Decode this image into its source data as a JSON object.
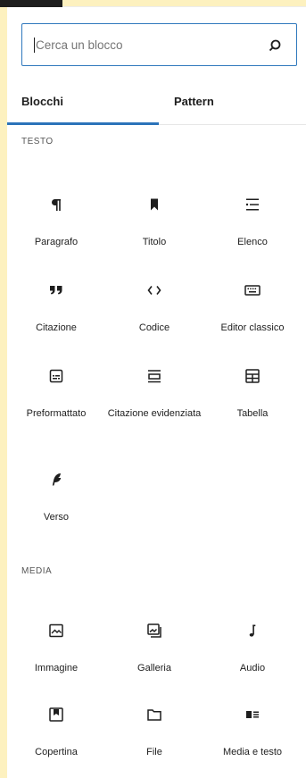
{
  "search": {
    "placeholder": "Cerca un blocco"
  },
  "tabs": [
    {
      "label": "Blocchi",
      "active": true
    },
    {
      "label": "Pattern",
      "active": false
    }
  ],
  "colors": {
    "accent": "#2c73b9",
    "background": "#fdf1bf"
  },
  "sections": [
    {
      "title": "TESTO",
      "blocks": [
        {
          "label": "Paragrafo",
          "icon": "paragraph-icon"
        },
        {
          "label": "Titolo",
          "icon": "heading-icon"
        },
        {
          "label": "Elenco",
          "icon": "list-icon"
        },
        {
          "label": "Citazione",
          "icon": "quote-icon"
        },
        {
          "label": "Codice",
          "icon": "code-icon"
        },
        {
          "label": "Editor classico",
          "icon": "keyboard-icon"
        },
        {
          "label": "Preformattato",
          "icon": "preformatted-icon"
        },
        {
          "label": "Citazione evidenziata",
          "icon": "pullquote-icon"
        },
        {
          "label": "Tabella",
          "icon": "table-icon"
        },
        {
          "label": "Verso",
          "icon": "verse-icon"
        }
      ]
    },
    {
      "title": "MEDIA",
      "blocks": [
        {
          "label": "Immagine",
          "icon": "image-icon"
        },
        {
          "label": "Galleria",
          "icon": "gallery-icon"
        },
        {
          "label": "Audio",
          "icon": "audio-icon"
        },
        {
          "label": "Copertina",
          "icon": "cover-icon"
        },
        {
          "label": "File",
          "icon": "file-icon"
        },
        {
          "label": "Media e testo",
          "icon": "media-text-icon"
        }
      ]
    }
  ]
}
